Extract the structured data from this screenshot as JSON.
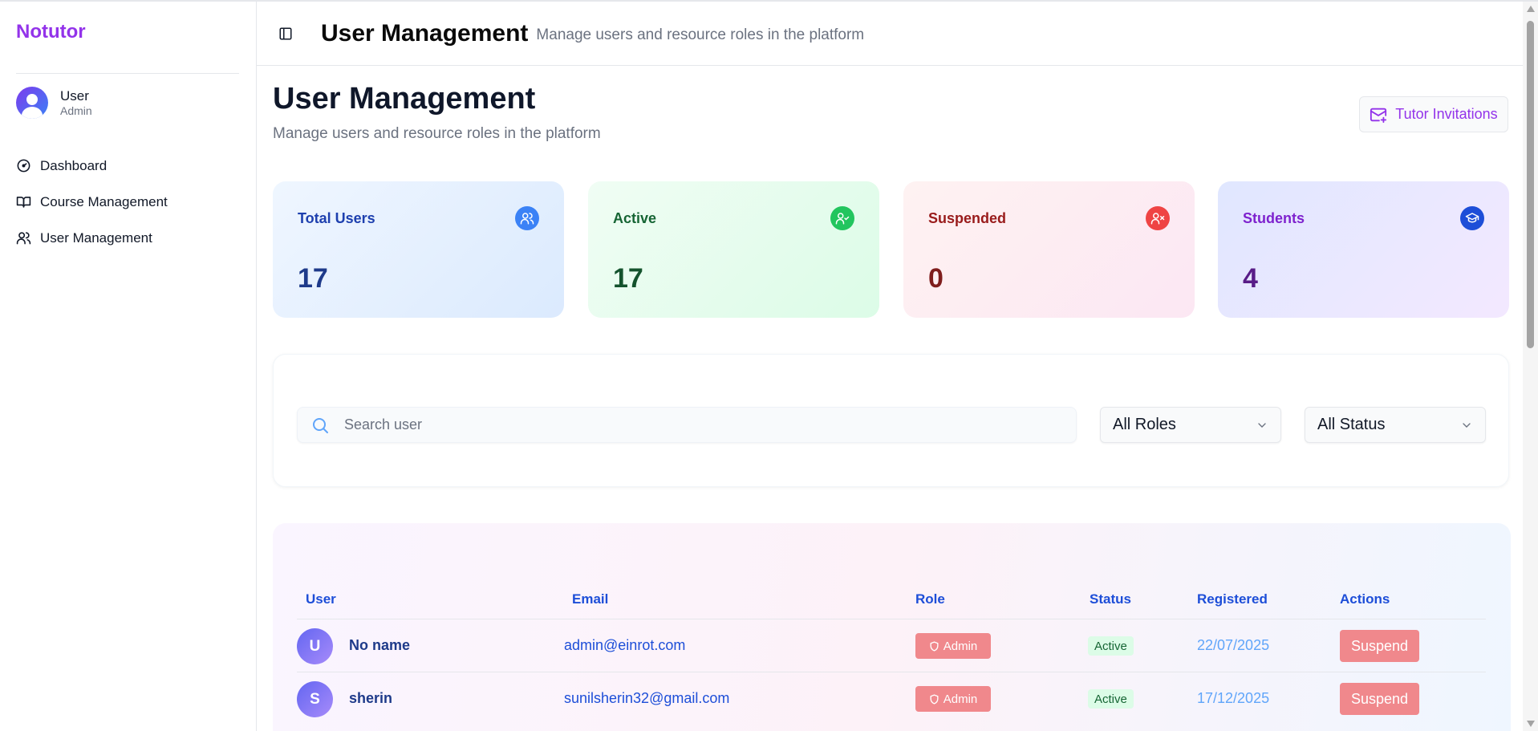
{
  "app": {
    "brand": "Notutor"
  },
  "user": {
    "name": "User",
    "role": "Admin"
  },
  "nav": [
    {
      "label": "Dashboard",
      "icon": "gauge-icon"
    },
    {
      "label": "Course Management",
      "icon": "book-open-icon"
    },
    {
      "label": "User Management",
      "icon": "users-icon"
    }
  ],
  "header": {
    "title": "User Management",
    "subtitle": "Manage users and resource roles in the platform"
  },
  "page": {
    "title": "User Management",
    "subtitle": "Manage users and resource roles in the platform",
    "invite_label": "Tutor Invitations"
  },
  "stats": [
    {
      "label": "Total Users",
      "value": "17",
      "icon": "users-icon"
    },
    {
      "label": "Active",
      "value": "17",
      "icon": "user-check-icon"
    },
    {
      "label": "Suspended",
      "value": "0",
      "icon": "user-x-icon"
    },
    {
      "label": "Students",
      "value": "4",
      "icon": "graduation-cap-icon"
    }
  ],
  "filters": {
    "search_placeholder": "Search user",
    "role_select": "All Roles",
    "status_select": "All Status"
  },
  "table": {
    "columns": [
      "User",
      "Email",
      "Role",
      "Status",
      "Registered",
      "Actions"
    ],
    "rows": [
      {
        "initial": "U",
        "name": "No name",
        "email": "admin@einrot.com",
        "role": "Admin",
        "status": "Active",
        "registered": "22/07/2025",
        "action": "Suspend"
      },
      {
        "initial": "S",
        "name": "sherin",
        "email": "sunilsherin32@gmail.com",
        "role": "Admin",
        "status": "Active",
        "registered": "17/12/2025",
        "action": "Suspend"
      }
    ]
  },
  "colors": {
    "brand": "#9333ea",
    "link_blue": "#1d4ed8",
    "danger_soft": "#f0888c",
    "success_bg": "#dcfce7"
  }
}
